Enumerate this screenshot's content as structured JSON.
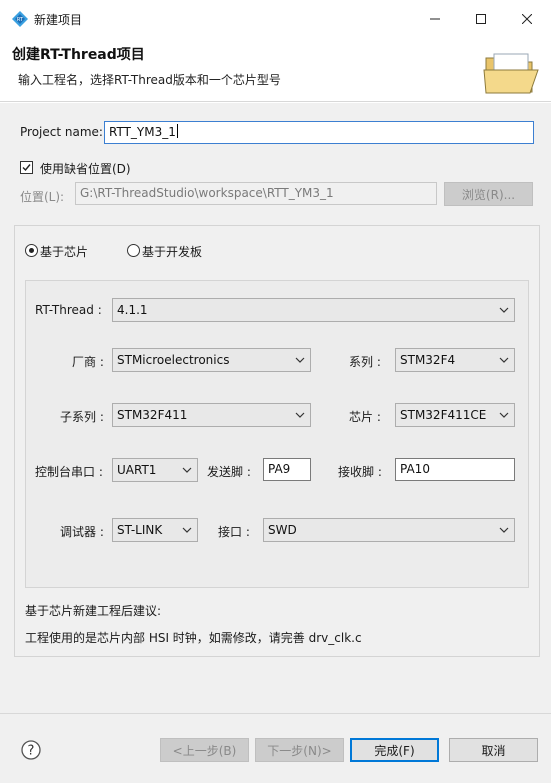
{
  "window": {
    "title": "新建项目",
    "minimize_icon": "minimize-icon",
    "maximize_icon": "maximize-icon",
    "close_icon": "close-icon"
  },
  "header": {
    "title": "创建RT-Thread项目",
    "description": "输入工程名，选择RT-Thread版本和一个芯片型号",
    "icon": "open-folder-icon"
  },
  "project": {
    "name_label": "Project name:",
    "name_value": "RTT_YM3_1",
    "default_location_label": "使用缺省位置(D)",
    "default_location_checked": true,
    "location_label": "位置(L):",
    "location_value": "G:\\RT-ThreadStudio\\workspace\\RTT_YM3_1",
    "browse_label": "浏览(R)..."
  },
  "mode": {
    "chip_label": "基于芯片",
    "board_label": "基于开发板",
    "selected": "chip"
  },
  "config": {
    "rtthread_label": "RT-Thread :",
    "rtthread_value": "4.1.1",
    "vendor_label": "厂商 :",
    "vendor_value": "STMicroelectronics",
    "series_label": "系列 :",
    "series_value": "STM32F4",
    "subseries_label": "子系列 :",
    "subseries_value": "STM32F411",
    "chip_label": "芯片 :",
    "chip_value": "STM32F411CE",
    "console_label": "控制台串口 :",
    "console_value": "UART1",
    "tx_label": "发送脚 :",
    "tx_value": "PA9",
    "rx_label": "接收脚 :",
    "rx_value": "PA10",
    "debugger_label": "调试器 :",
    "debugger_value": "ST-LINK",
    "interface_label": "接口 :",
    "interface_value": "SWD"
  },
  "advice": {
    "title": "基于芯片新建工程后建议:",
    "text": "工程使用的是芯片内部 HSI 时钟，如需修改，请完善 drv_clk.c"
  },
  "footer": {
    "help_icon": "help-icon",
    "back_label": "<上一步(B)",
    "next_label": "下一步(N)>",
    "finish_label": "完成(F)",
    "cancel_label": "取消"
  }
}
